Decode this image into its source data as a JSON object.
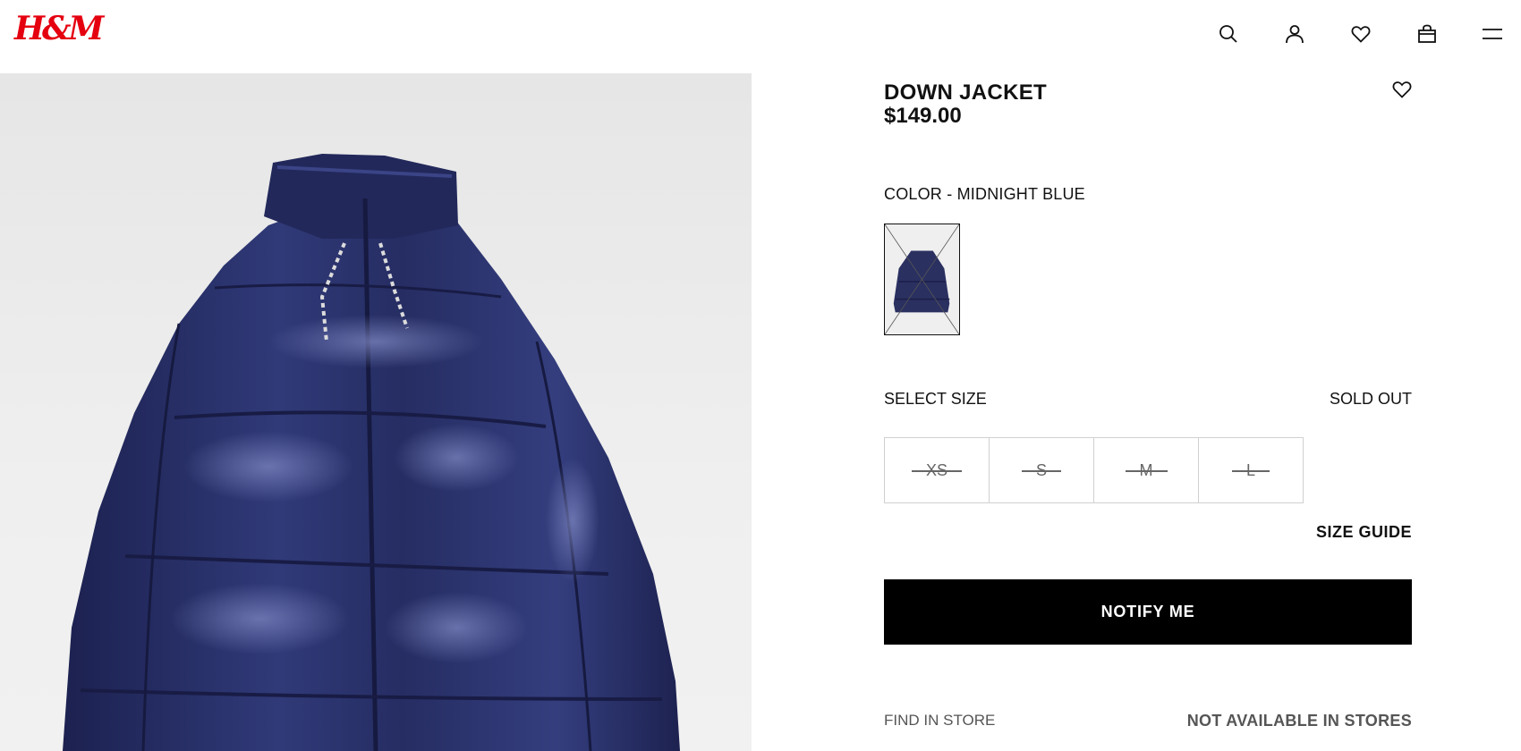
{
  "header": {
    "logo": "H&M",
    "icons": [
      "search-icon",
      "account-icon",
      "favorites-icon",
      "shopping-bag-icon",
      "menu-icon"
    ]
  },
  "product": {
    "title": "DOWN JACKET",
    "price": "$149.00",
    "color_label": "COLOR - MIDNIGHT BLUE",
    "color_hex": "#2a3060",
    "select_size_label": "SELECT SIZE",
    "sold_out_label": "SOLD OUT",
    "sizes": [
      {
        "label": "XS"
      },
      {
        "label": "S"
      },
      {
        "label": "M"
      },
      {
        "label": "L"
      }
    ],
    "size_guide_label": "SIZE GUIDE",
    "notify_button": "NOTIFY ME",
    "find_in_store": "FIND IN STORE",
    "store_availability": "NOT AVAILABLE IN STORES"
  },
  "colors": {
    "brand": "#e50010",
    "jacket": "#2a3060"
  }
}
